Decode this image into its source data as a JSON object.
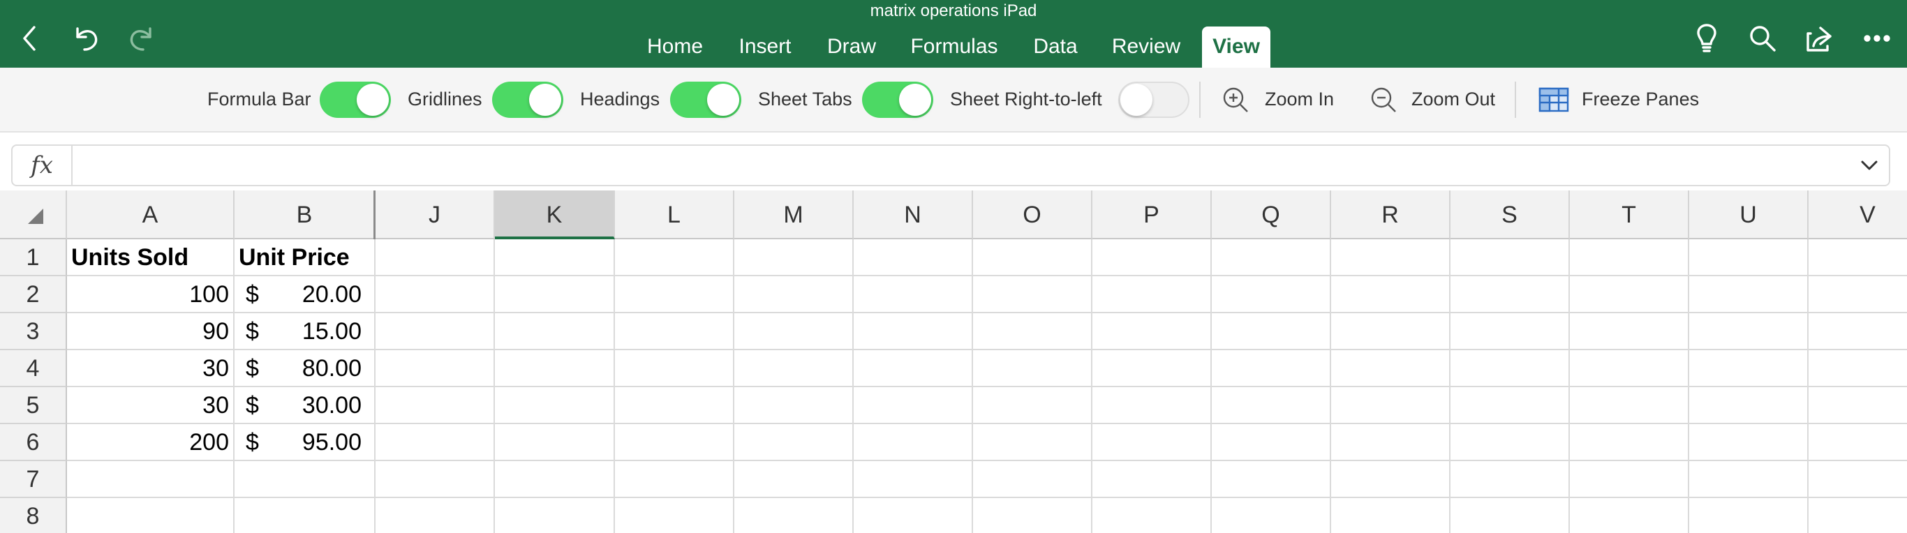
{
  "document": {
    "title": "matrix operations iPad"
  },
  "nav": {
    "back_icon": "back-chevron-icon",
    "undo_icon": "undo-icon",
    "redo_icon": "redo-icon"
  },
  "tabs": [
    {
      "label": "Home",
      "active": false
    },
    {
      "label": "Insert",
      "active": false
    },
    {
      "label": "Draw",
      "active": false
    },
    {
      "label": "Formulas",
      "active": false
    },
    {
      "label": "Data",
      "active": false
    },
    {
      "label": "Review",
      "active": false
    },
    {
      "label": "View",
      "active": true
    }
  ],
  "right_icons": [
    "lightbulb-icon",
    "search-icon",
    "share-icon",
    "more-icon"
  ],
  "ribbon": {
    "toggles": [
      {
        "label": "Formula Bar",
        "on": true
      },
      {
        "label": "Gridlines",
        "on": true
      },
      {
        "label": "Headings",
        "on": true
      },
      {
        "label": "Sheet Tabs",
        "on": true
      },
      {
        "label": "Sheet Right-to-left",
        "on": false
      }
    ],
    "zoom_in": "Zoom In",
    "zoom_out": "Zoom Out",
    "freeze_panes": "Freeze Panes"
  },
  "formula_bar": {
    "fx": "fx",
    "value": ""
  },
  "grid": {
    "columns": [
      "A",
      "B",
      "J",
      "K",
      "L",
      "M",
      "N",
      "O",
      "P",
      "Q",
      "R",
      "S",
      "T",
      "U",
      "V"
    ],
    "selected_column": "K",
    "rows": [
      "1",
      "2",
      "3",
      "4",
      "5",
      "6",
      "7",
      "8"
    ],
    "headers": {
      "A": "Units Sold",
      "B": "Unit Price"
    },
    "data": [
      {
        "units": "100",
        "currency": "$",
        "price": "20.00"
      },
      {
        "units": "90",
        "currency": "$",
        "price": "15.00"
      },
      {
        "units": "30",
        "currency": "$",
        "price": "80.00"
      },
      {
        "units": "30",
        "currency": "$",
        "price": "30.00"
      },
      {
        "units": "200",
        "currency": "$",
        "price": "95.00"
      }
    ]
  }
}
